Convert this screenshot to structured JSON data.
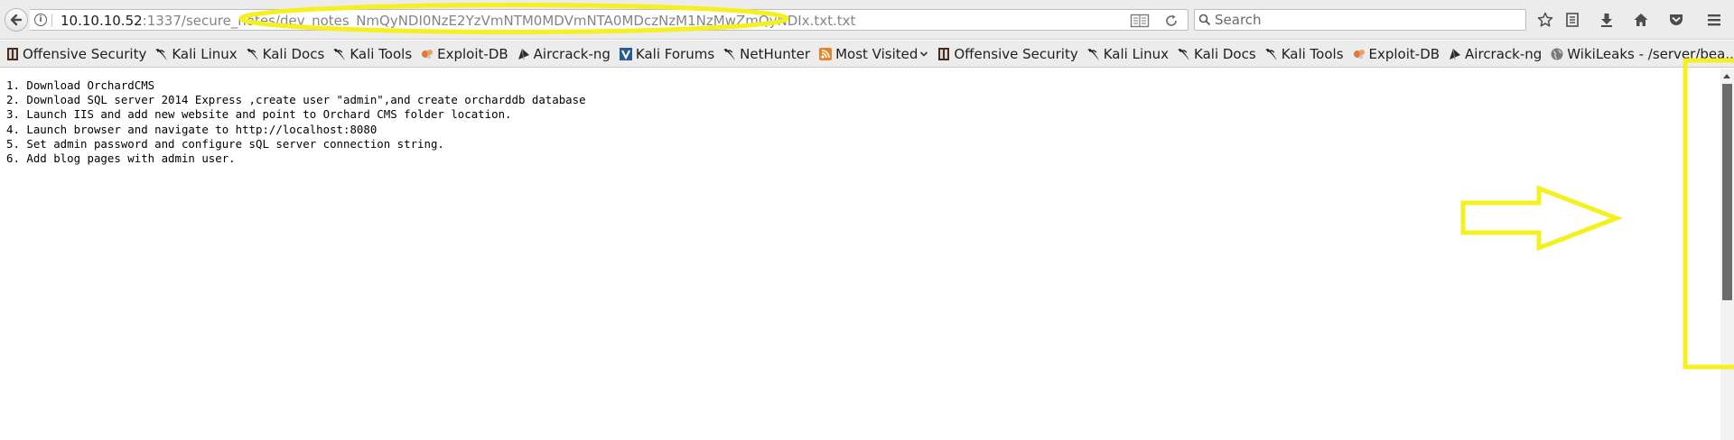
{
  "browser": {
    "url": {
      "host": "10.10.10.52",
      "path": ":1337/secure_notes/dev_notes_NmQyNDI0NzE2YzVmNTM0MDVmNTA0MDczNzM1NzMwZmQyNDIx.txt.txt"
    },
    "search": {
      "placeholder": "Search"
    },
    "toolbar_icons": [
      "bookmark-star-icon",
      "reading-list-icon",
      "downloads-icon",
      "home-icon",
      "pocket-icon",
      "menu-icon"
    ]
  },
  "bookmarks": [
    {
      "label": "Offensive Security",
      "icon": "offsec-icon"
    },
    {
      "label": "Kali Linux",
      "icon": "kali-dragon-icon"
    },
    {
      "label": "Kali Docs",
      "icon": "kali-dragon-icon"
    },
    {
      "label": "Kali Tools",
      "icon": "kali-dragon-icon"
    },
    {
      "label": "Exploit-DB",
      "icon": "exploitdb-icon"
    },
    {
      "label": "Aircrack-ng",
      "icon": "aircrack-icon"
    },
    {
      "label": "Kali Forums",
      "icon": "kali-forums-icon"
    },
    {
      "label": "NetHunter",
      "icon": "kali-dragon-icon"
    },
    {
      "label": "Most Visited",
      "icon": "rss-icon"
    },
    {
      "label": "Offensive Security",
      "icon": "offsec-icon"
    },
    {
      "label": "Kali Linux",
      "icon": "kali-dragon-icon"
    },
    {
      "label": "Kali Docs",
      "icon": "kali-dragon-icon"
    },
    {
      "label": "Kali Tools",
      "icon": "kali-dragon-icon"
    },
    {
      "label": "Exploit-DB",
      "icon": "exploitdb-icon"
    },
    {
      "label": "Aircrack-ng",
      "icon": "aircrack-icon"
    },
    {
      "label": "WikiLeaks - /server/bea...",
      "icon": "globe-icon"
    }
  ],
  "document": {
    "lines": [
      "1. Download OrchardCMS",
      "2. Download SQL server 2014 Express ,create user \"admin\",and create orcharddb database",
      "3. Launch IIS and add new website and point to Orchard CMS folder location.",
      "4. Launch browser and navigate to http://localhost:8080",
      "5. Set admin password and configure sQL server connection string.",
      "6. Add blog pages with admin user."
    ]
  },
  "colors": {
    "annotation": "#f5f020",
    "chrome": "#ececec",
    "scroll_thumb": "#6b6b6b"
  }
}
